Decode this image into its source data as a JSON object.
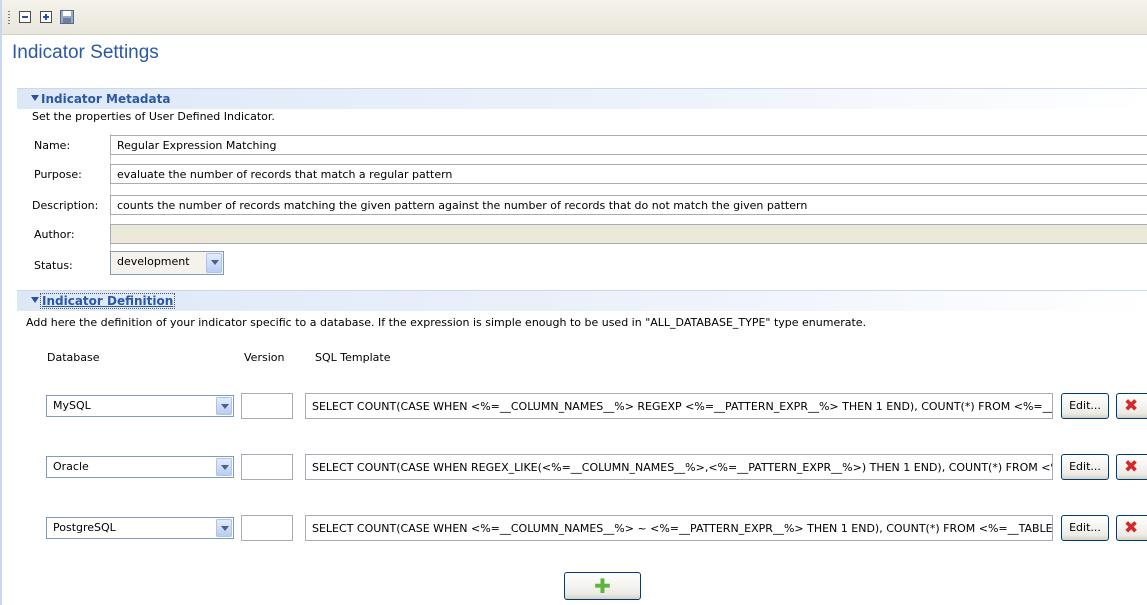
{
  "toolbar": {
    "icons": [
      "collapse-all-icon",
      "expand-all-icon",
      "save-icon"
    ]
  },
  "page_title": "Indicator Settings",
  "metadata": {
    "section_title": "Indicator Metadata",
    "description": "Set the properties of User Defined Indicator.",
    "name_label": "Name:",
    "name_value": "Regular Expression Matching",
    "purpose_label": "Purpose:",
    "purpose_value": "evaluate the number of records that match a regular pattern",
    "description_label": "Description:",
    "description_value": "counts the number of records matching the given pattern against the number of records that do not match the given pattern",
    "author_label": "Author:",
    "author_value": "",
    "status_label": "Status:",
    "status_value": "development"
  },
  "definition": {
    "section_title": "Indicator Definition",
    "description": "Add here the definition of your indicator specific to a database. If the expression is simple enough to be used in \"ALL_DATABASE_TYPE\" type enumerate.",
    "col_database": "Database",
    "col_version": "Version",
    "col_sql": "SQL Template",
    "rows": [
      {
        "database": "MySQL",
        "version": "",
        "sql": "SELECT COUNT(CASE WHEN <%=__COLUMN_NAMES__%> REGEXP <%=__PATTERN_EXPR__%> THEN 1 END), COUNT(*) FROM <%=__TABLE_NAME__%> <%=__WHERE_CLAUSE__%>",
        "edit_label": "Edit..."
      },
      {
        "database": "Oracle",
        "version": "",
        "sql": "SELECT COUNT(CASE WHEN REGEX_LIKE(<%=__COLUMN_NAMES__%>,<%=__PATTERN_EXPR__%>) THEN 1 END), COUNT(*) FROM <%=__TABLE_NAME__%> <%=__WHERE_CLAUSE__%>",
        "edit_label": "Edit..."
      },
      {
        "database": "PostgreSQL",
        "version": "",
        "sql": "SELECT COUNT(CASE WHEN <%=__COLUMN_NAMES__%> ~ <%=__PATTERN_EXPR__%> THEN 1 END), COUNT(*) FROM <%=__TABLE_NAME__%> <%=__WHERE_CLAUSE__%>",
        "edit_label": "Edit..."
      }
    ],
    "delete_icon": "red-x-icon",
    "add_icon": "green-plus-icon"
  },
  "colors": {
    "title_blue": "#2b58a5",
    "delete_red": "#d4282b",
    "add_green": "#5fb43a"
  }
}
